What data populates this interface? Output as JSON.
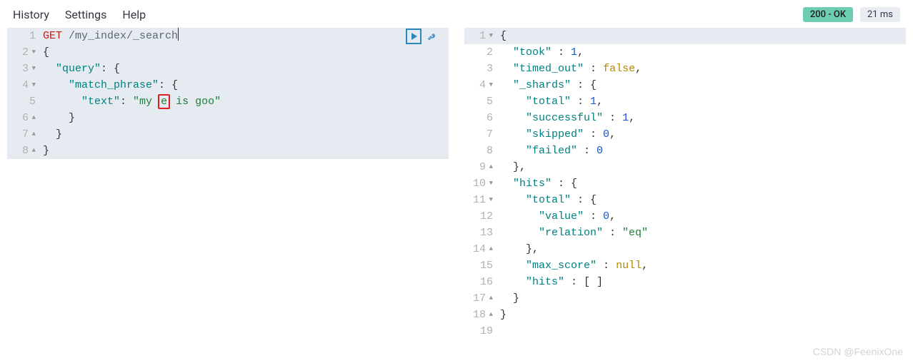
{
  "menu": {
    "history": "History",
    "settings": "Settings",
    "help": "Help"
  },
  "status": {
    "code": "200 - OK",
    "latency": "21 ms"
  },
  "request": {
    "method": "GET",
    "path": "/my_index/_search",
    "body": {
      "query": {
        "match_phrase": {
          "text": "my e is goo"
        }
      }
    },
    "highlight_char": "e",
    "tokens": {
      "query": "\"query\"",
      "match_phrase": "\"match_phrase\"",
      "text": "\"text\"",
      "str_pre": "\"my ",
      "str_box": "e",
      "str_post": " is goo\"",
      "brace_open": "{",
      "brace_close": "}",
      "colon_sp": ": "
    },
    "gutter": [
      "1",
      "2",
      "3",
      "4",
      "5",
      "6",
      "7",
      "8"
    ]
  },
  "response": {
    "took": 1,
    "timed_out": false,
    "_shards": {
      "total": 1,
      "successful": 1,
      "skipped": 0,
      "failed": 0
    },
    "hits": {
      "total": {
        "value": 0,
        "relation": "eq"
      },
      "max_score": null,
      "hits": []
    },
    "tokens": {
      "took": "\"took\"",
      "took_v": "1",
      "timed_out": "\"timed_out\"",
      "false": "false",
      "shards": "\"_shards\"",
      "total": "\"total\"",
      "total_v1": "1",
      "successful": "\"successful\"",
      "succ_v": "1",
      "skipped": "\"skipped\"",
      "skip_v": "0",
      "failed": "\"failed\"",
      "fail_v": "0",
      "hits": "\"hits\"",
      "value": "\"value\"",
      "value_v": "0",
      "relation": "\"relation\"",
      "relation_v": "\"eq\"",
      "max_score": "\"max_score\"",
      "null": "null",
      "hits_arr": "[ ]",
      "brace_open": "{",
      "brace_close": "}",
      "comma": ",",
      "colon": " : "
    },
    "gutter": [
      "1",
      "2",
      "3",
      "4",
      "5",
      "6",
      "7",
      "8",
      "9",
      "10",
      "11",
      "12",
      "13",
      "14",
      "15",
      "16",
      "17",
      "18",
      "19"
    ]
  },
  "watermark": "CSDN @FeenixOne"
}
